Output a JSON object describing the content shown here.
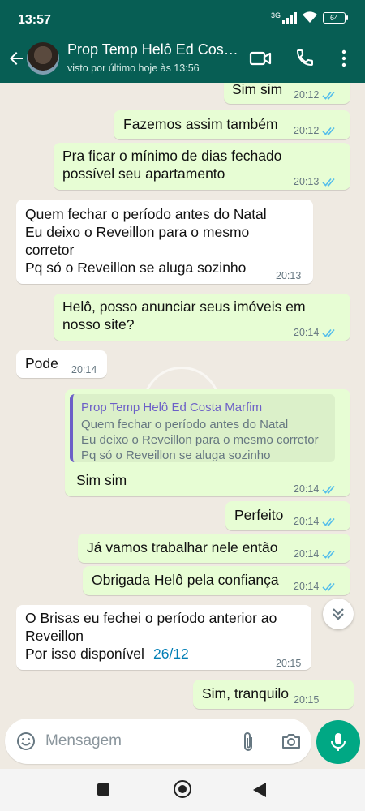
{
  "status_bar": {
    "time": "13:57",
    "network": "3G",
    "battery": "64"
  },
  "header": {
    "name": "Prop Temp Helô Ed Costa Marfim",
    "last_seen": "visto por último hoje às 13:56"
  },
  "messages": [
    {
      "dir": "out",
      "lines": [
        "Sim sim"
      ],
      "time": "20:12",
      "ticks": "read"
    },
    {
      "dir": "out",
      "lines": [
        "Fazemos assim também"
      ],
      "time": "20:12",
      "ticks": "read"
    },
    {
      "dir": "out",
      "lines": [
        "Pra ficar o mínimo de dias fechado",
        "possível seu apartamento"
      ],
      "time": "20:13",
      "ticks": "read"
    },
    {
      "dir": "in",
      "lines": [
        "Quem fechar o período antes do Natal",
        "Eu deixo o Reveillon para o mesmo",
        "corretor",
        "Pq só o Reveillon se aluga sozinho"
      ],
      "time": "20:13"
    },
    {
      "dir": "out",
      "lines": [
        "Helô, posso anunciar seus imóveis em",
        "nosso site?"
      ],
      "time": "20:14",
      "ticks": "read"
    },
    {
      "dir": "in",
      "lines": [
        "Pode"
      ],
      "time": "20:14"
    },
    {
      "dir": "out",
      "quote": {
        "author": "Prop Temp Helô Ed Costa Marfim",
        "lines": [
          "Quem fechar o período antes do Natal",
          "Eu deixo o Reveillon para o mesmo corretor",
          "Pq só o Reveillon se aluga sozinho"
        ]
      },
      "lines": [
        "Sim sim"
      ],
      "time": "20:14",
      "ticks": "read"
    },
    {
      "dir": "out",
      "lines": [
        "Perfeito"
      ],
      "time": "20:14",
      "ticks": "read"
    },
    {
      "dir": "out",
      "lines": [
        "Já vamos trabalhar nele então"
      ],
      "time": "20:14",
      "ticks": "read"
    },
    {
      "dir": "out",
      "lines": [
        "Obrigada Helô pela confiança"
      ],
      "time": "20:14",
      "ticks": "read"
    },
    {
      "dir": "in",
      "lines": [
        "O Brisas eu fechei o período anterior ao",
        "Reveillon",
        "Por isso disponível"
      ],
      "link": "26/12",
      "time": "20:15"
    },
    {
      "dir": "out",
      "lines": [
        "Sim, tranquilo"
      ],
      "time": "20:15"
    }
  ],
  "composer": {
    "placeholder": "Mensagem"
  },
  "icons": {
    "back": "arrow-left-icon",
    "video": "video-call-icon",
    "call": "phone-icon",
    "menu": "more-vert-icon",
    "emoji": "emoji-icon",
    "attach": "paperclip-icon",
    "camera": "camera-icon",
    "mic": "mic-icon",
    "scroll": "double-chevron-down-icon"
  },
  "colors": {
    "header": "#075e54",
    "outgoing": "#e7fdd4",
    "incoming": "#ffffff",
    "read_ticks": "#53bdeb",
    "accent": "#00a884",
    "quote_author": "#6c5fc7",
    "link": "#027eb5"
  }
}
